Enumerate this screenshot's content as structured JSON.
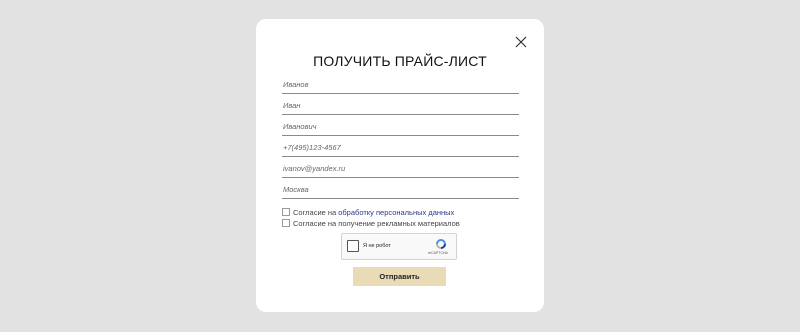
{
  "modal": {
    "title": "ПОЛУЧИТЬ ПРАЙС-ЛИСТ",
    "close_icon": "close-icon"
  },
  "form": {
    "fields": [
      {
        "name": "last-name",
        "placeholder": "Иванов"
      },
      {
        "name": "first-name",
        "placeholder": "Иван"
      },
      {
        "name": "middle-name",
        "placeholder": "Иванович"
      },
      {
        "name": "phone",
        "placeholder": "+7(495)123-4567"
      },
      {
        "name": "email",
        "placeholder": "ivanov@yandex.ru"
      },
      {
        "name": "city",
        "placeholder": "Москва"
      }
    ],
    "consent_personal_prefix": "Согласие на",
    "consent_personal_link": "обработку персональных данных",
    "consent_ads": "Согласие на получение рекламных материалов",
    "captcha": {
      "label": "Я не робот",
      "brand": "reCAPTCHA",
      "logo_icon": "recaptcha-logo-icon"
    },
    "submit_label": "Отправить"
  },
  "colors": {
    "backdrop": "#e2e2e2",
    "modal_bg": "#ffffff",
    "submit_bg": "#e9dbb5",
    "link": "#2b3a8c"
  }
}
